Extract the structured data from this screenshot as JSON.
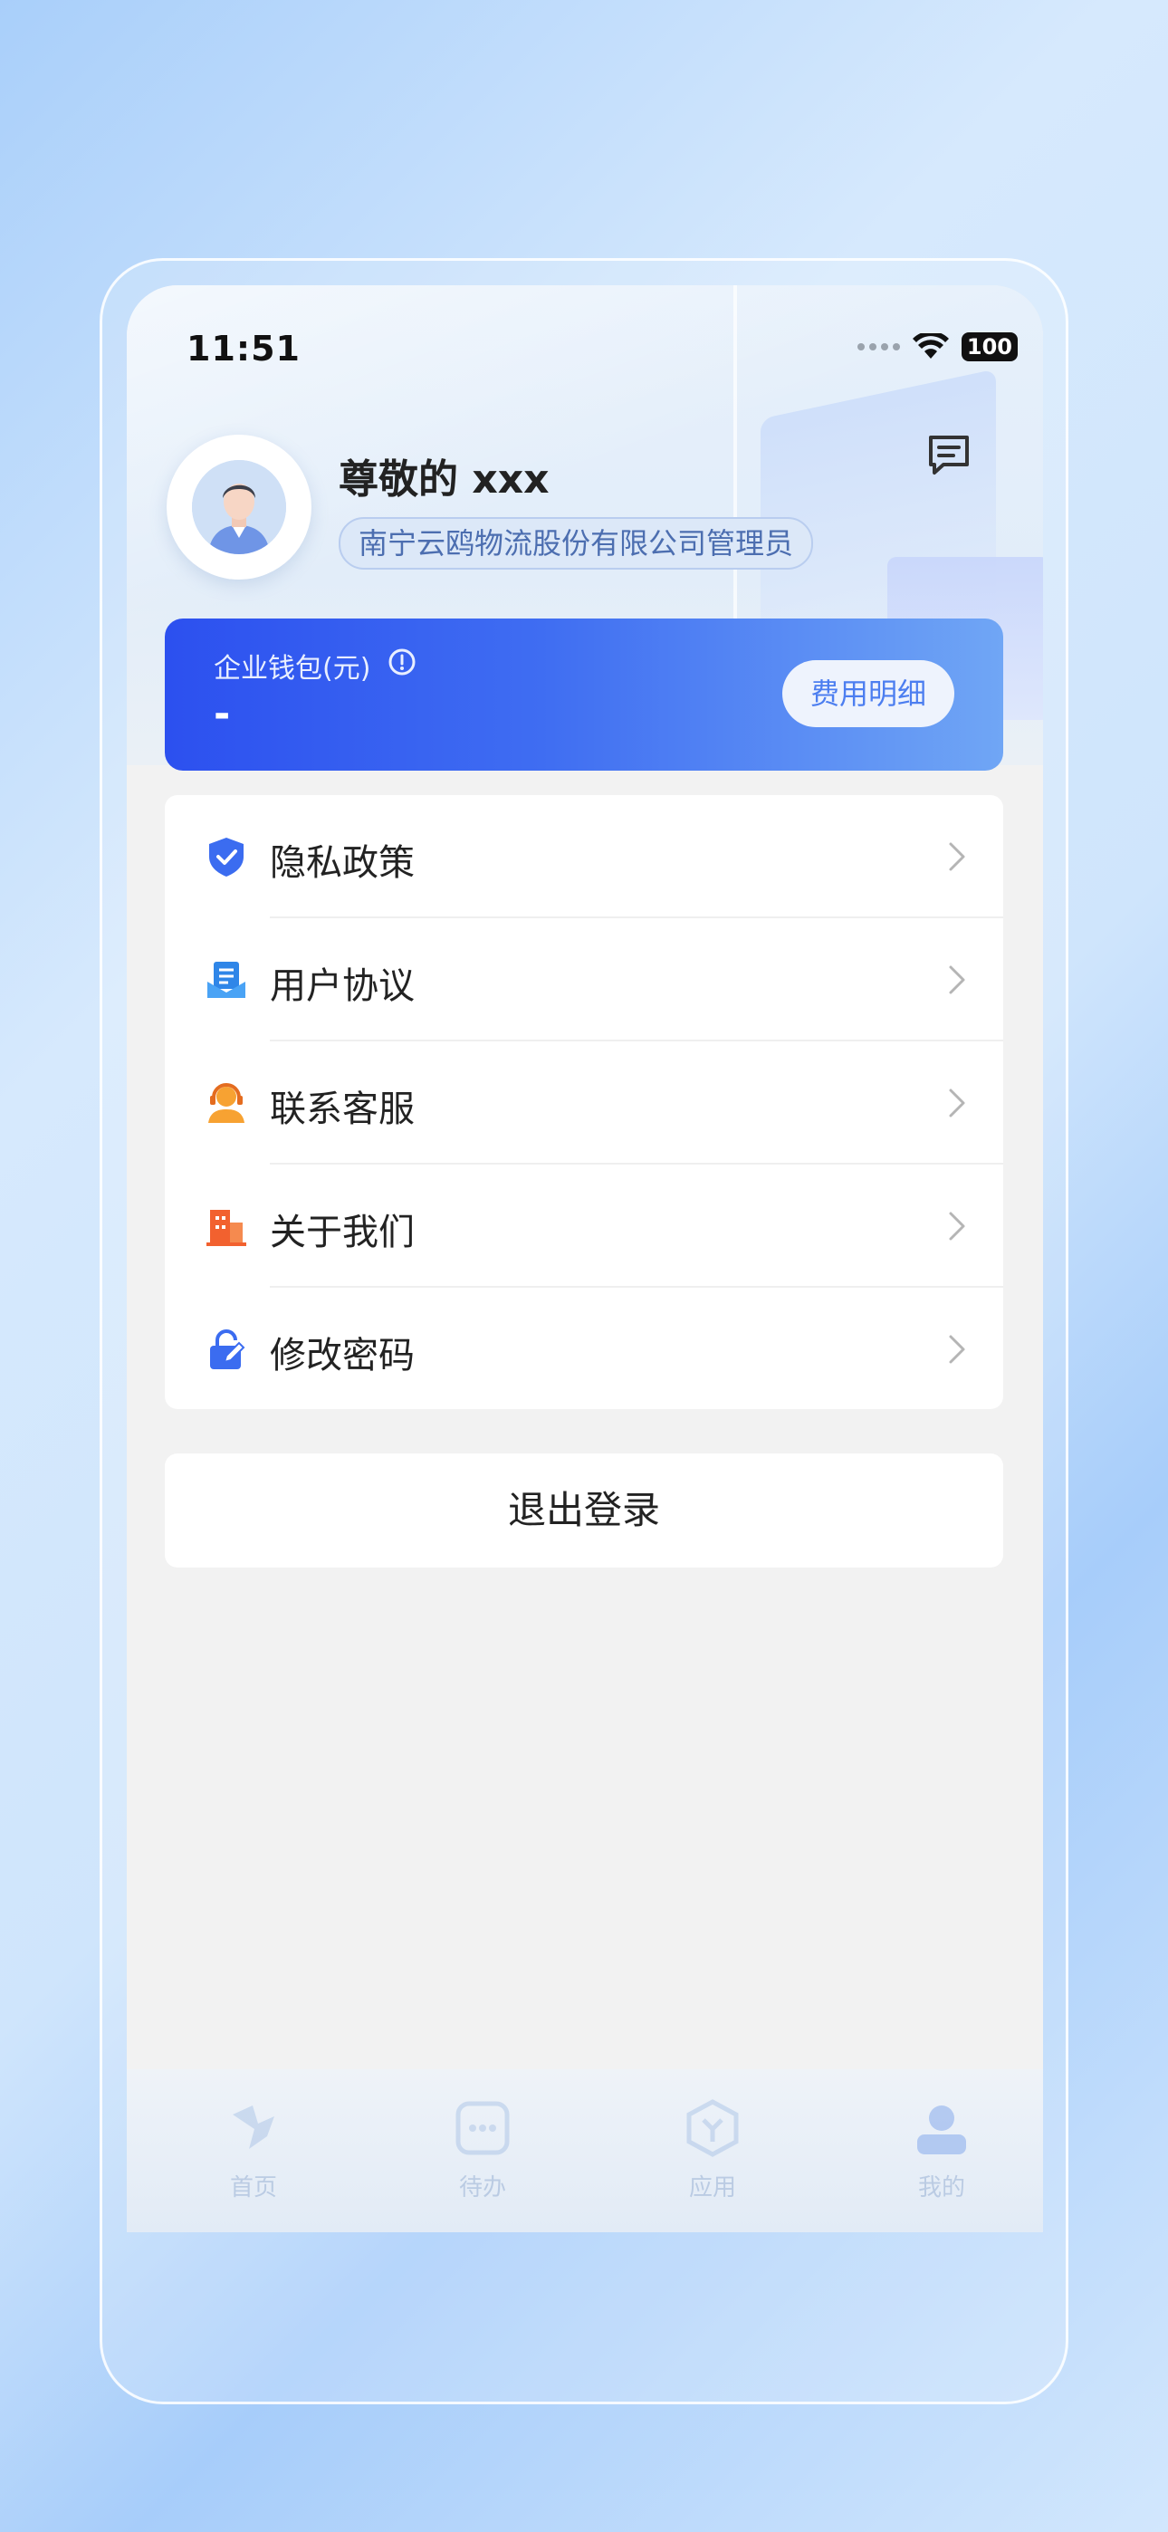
{
  "status_bar": {
    "time": "11:51",
    "battery": "100"
  },
  "profile": {
    "greeting": "尊敬的 xxx",
    "role": "南宁云鸥物流股份有限公司管理员"
  },
  "wallet": {
    "label": "企业钱包(元)",
    "value": "-",
    "fee_button": "费用明细"
  },
  "menu": {
    "items": [
      {
        "label": "隐私政策",
        "icon": "shield-check-icon"
      },
      {
        "label": "用户协议",
        "icon": "document-icon"
      },
      {
        "label": "联系客服",
        "icon": "customer-service-icon"
      },
      {
        "label": "关于我们",
        "icon": "building-icon"
      },
      {
        "label": "修改密码",
        "icon": "lock-edit-icon"
      }
    ]
  },
  "logout_label": "退出登录",
  "tabbar": {
    "items": [
      {
        "label": "首页",
        "icon": "home-icon"
      },
      {
        "label": "待办",
        "icon": "todo-icon"
      },
      {
        "label": "应用",
        "icon": "apps-icon"
      },
      {
        "label": "我的",
        "icon": "profile-icon"
      }
    ]
  },
  "colors": {
    "wallet_start": "#2c50ef",
    "wallet_end": "#70a6f5",
    "accent": "#4c7ef0"
  }
}
